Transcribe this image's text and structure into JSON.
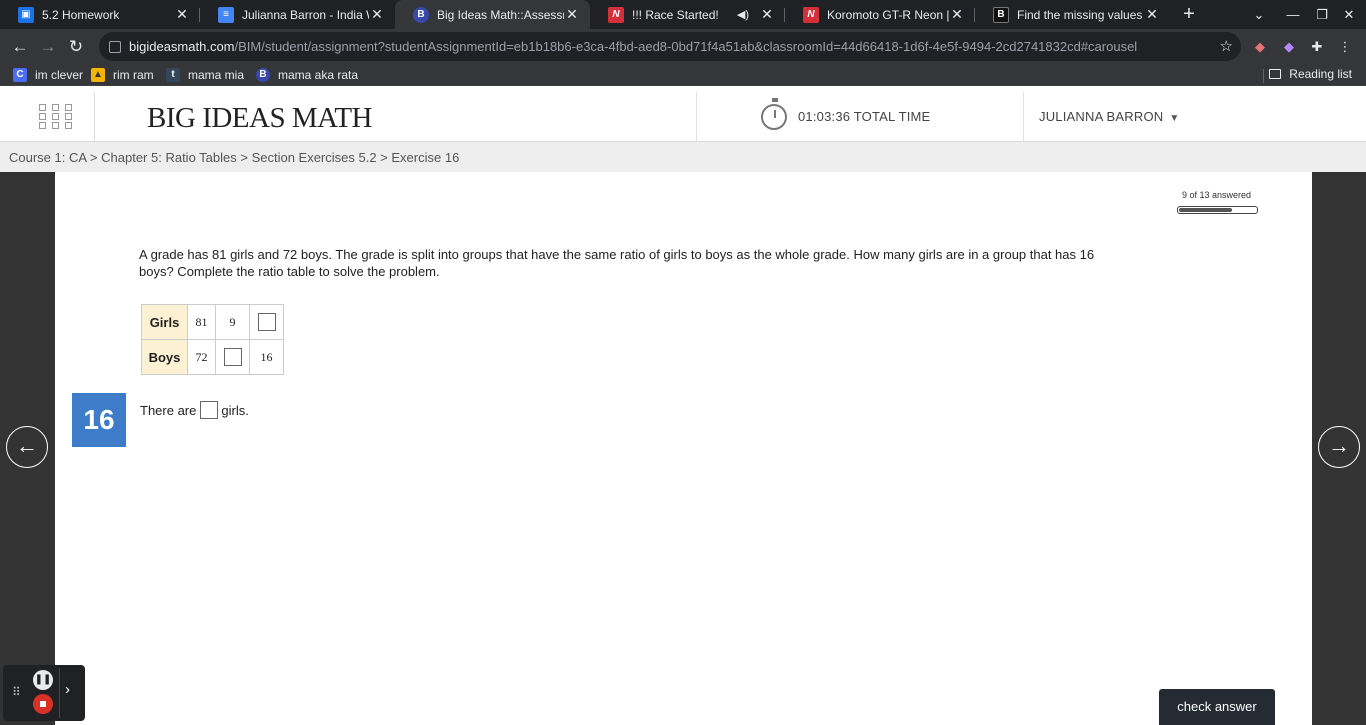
{
  "browser": {
    "tabs": [
      {
        "title": "5.2 Homework",
        "icon": "classroom-icon",
        "icon_color": "#1a73e8",
        "active": false
      },
      {
        "title": "Julianna Barron - India Wrap",
        "icon": "docs-icon",
        "icon_color": "#4285f4",
        "active": false
      },
      {
        "title": "Big Ideas Math::Assessment",
        "icon": "bigideas-icon",
        "icon_color": "#3949ab",
        "active": true
      },
      {
        "title": "!!! Race Started!",
        "icon": "nitrotype-icon",
        "icon_color": "#d62f3a",
        "active": false,
        "audio": true
      },
      {
        "title": "Koromoto GT-R Neon | Nitro",
        "icon": "nitrotype-icon",
        "icon_color": "#d62f3a",
        "active": false
      },
      {
        "title": "Find the missing values in th",
        "icon": "brainly-icon",
        "icon_color": "#111111",
        "active": false
      }
    ],
    "url_host": "bigideasmath.com",
    "url_path": "/BIM/student/assignment?studentAssignmentId=eb1b18b6-e3ca-4fbd-aed8-0bd71f4a51ab&classroomId=44d66418-1d6f-4e5f-9494-2cd2741832cd#carousel",
    "bookmarks": [
      {
        "label": "im clever",
        "icon": "c-icon",
        "icon_color": "#4a6cf7"
      },
      {
        "label": "rim ram",
        "icon": "image-icon",
        "icon_color": "#f4b400"
      },
      {
        "label": "mama mia",
        "icon": "tumblr-icon",
        "icon_color": "#35465c"
      },
      {
        "label": "mama aka rata",
        "icon": "bigideas-icon",
        "icon_color": "#3949ab"
      }
    ],
    "reading_list": "Reading list"
  },
  "site": {
    "logo": "BIG IDEAS MATH",
    "timer": "01:03:36 TOTAL TIME",
    "user": "JULIANNA BARRON",
    "breadcrumb": "Course 1: CA > Chapter 5: Ratio Tables > Section Exercises 5.2 > Exercise 16"
  },
  "assessment": {
    "progress_label": "9 of 13 answered",
    "progress_fraction": 0.692,
    "question": "A grade has 81 girls and 72 boys.  The grade is split into groups that have the same ratio of girls to boys as the whole grade.  How many girls are in a group that has 16 boys? Complete the ratio table to solve the problem.",
    "table": {
      "rows": [
        {
          "label": "Girls",
          "cells": [
            "81",
            "9",
            ""
          ]
        },
        {
          "label": "Boys",
          "cells": [
            "72",
            "",
            "16"
          ]
        }
      ]
    },
    "number": "16",
    "answer_prefix": "There are",
    "answer_suffix": "girls.",
    "check_button": "check answer"
  },
  "colors": {
    "question_number_bg": "#3d7cc9",
    "table_header_bg": "#fdf1d4",
    "check_button_bg": "#252b33"
  }
}
